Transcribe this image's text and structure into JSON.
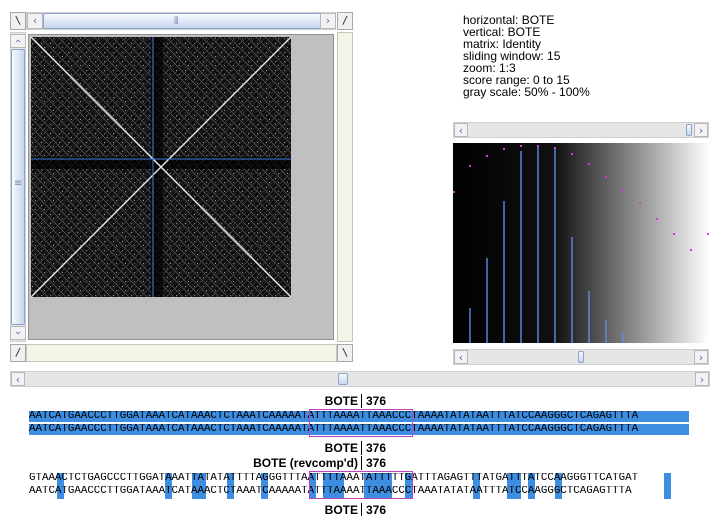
{
  "corners": {
    "top_left": "\\",
    "top_right": "/",
    "bottom_left": "/",
    "bottom_right": "\\"
  },
  "scroll": {
    "left": "‹",
    "right": "›",
    "up": "‹",
    "down": "›",
    "grip_h": "⦀",
    "grip_v": "≡"
  },
  "params": {
    "horizontal": "horizontal: BOTE",
    "vertical": "vertical: BOTE",
    "matrix": "matrix: Identity",
    "window": "sliding window: 15",
    "zoom": "zoom: 1:3",
    "score": "score range: 0 to 15",
    "gray": "gray scale: 50% - 100%"
  },
  "alignment1": {
    "header_name": "BOTE",
    "header_pos": "376",
    "line1": "AATCATGAACCCTTGGATAAATCATAAACTCTAAATCAAAAATATTTAAAATTAAACCCTAAAATATATAATTTATCCAAGGGCTCAGAGTTTA",
    "line2": "AATCATGAACCCTTGGATAAATCATAAACTCTAAATCAAAAATATTTAAAATTAAACCCTAAAATATATAATTTATCCAAGGGCTCAGAGTTTA",
    "footer_name": "BOTE",
    "footer_pos": "376"
  },
  "alignment2": {
    "header_name": "BOTE (revcomp'd)",
    "header_pos": "376",
    "line1": "GTAAACTCTGAGCCCTTGGATAAATTATATATTTTAGGGTTTAATTTTAAATATTTTTGATTTAGAGTTTATGATTTATCCAAGGGTTCATGAT",
    "line2": "AATCATGAACCCTTGGATAAATCATAAACTCTAAATCAAAAATATTTAAAATTAAACCCTAAATATATAATTTATCCAAGGGCTCAGAGTTTA",
    "footer_name": "BOTE",
    "footer_pos": "376"
  },
  "colors": {
    "highlight": "#3d8de0",
    "crosshair": "#3f7fe0",
    "window_box": "#c040c0"
  }
}
